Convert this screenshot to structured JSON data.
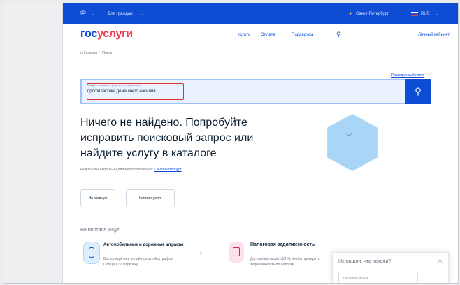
{
  "topbar": {
    "emblem_icon": "coat-of-arms-icon",
    "citizens_label": "Для граждан",
    "location": "Санкт-Петербург",
    "language": "RUS"
  },
  "header": {
    "logo_part1": "гос",
    "logo_part2": "услуги",
    "nav": [
      "Услуги",
      "Оплата",
      "Поддержка"
    ],
    "cabinet_label": "Личный кабинет"
  },
  "breadcrumbs": {
    "home": "Главная",
    "current": "Поиск"
  },
  "search": {
    "advanced_link": "Расширенный поиск",
    "hint": "Введите название услуги или ведомства",
    "query": "профилактика домашнего насилия",
    "button_icon": "search-icon"
  },
  "result": {
    "message_lines": [
      "Ничего не найдено. Попробуйте",
      "исправить поисковый запрос или",
      "найдите услугу в каталоге"
    ],
    "note_prefix": "Результаты актуальны для местоположения:",
    "note_city": "Санкт-Петербург",
    "buttons": [
      "На главную",
      "Каталог услуг"
    ]
  },
  "portal": {
    "heading": "На портале ищут",
    "cards": [
      {
        "icon": "traffic-light-icon",
        "title": "Автомобильные и дорожные штрафы",
        "desc": "Воспользуйтесь онлайн-оплатой штрафов ГИБДД и за парковку"
      },
      {
        "icon": "tax-document-icon",
        "title": "Налоговая задолженность",
        "desc": "Достаточно вашего ИНН, чтобы проверить задолженность по налогам"
      }
    ]
  },
  "widget": {
    "title": "Не нашли, что искали?",
    "feedback_placeholder": "Оставьте отзыв"
  },
  "colors": {
    "brand_blue": "#0d4cd3",
    "brand_red": "#ee3f58",
    "highlight": "#e02f2f"
  }
}
